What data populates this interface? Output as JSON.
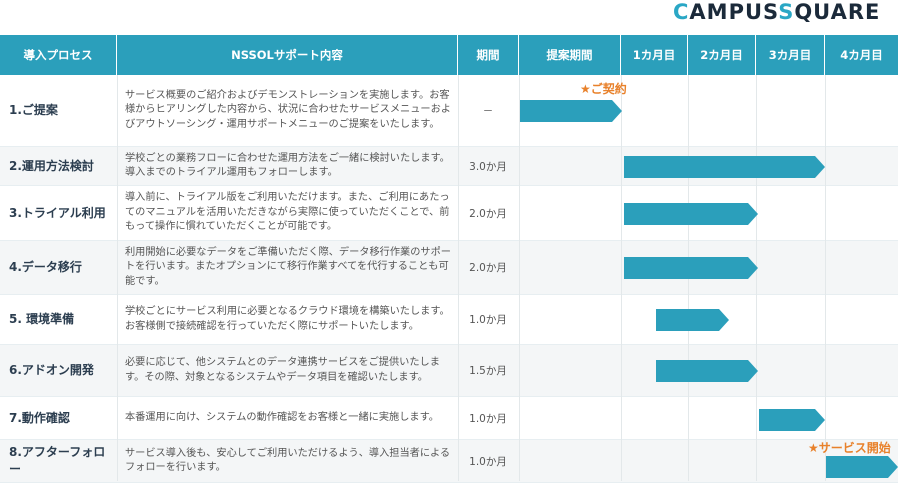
{
  "logo": {
    "part1": "C",
    "part2": "AMPUS",
    "part3": "S",
    "part4": "QUARE"
  },
  "headers": {
    "process": "導入プロセス",
    "content": "NSSOLサポート内容",
    "period": "期間",
    "proposal": "提案期間",
    "m1": "1カ月目",
    "m2": "2カ月目",
    "m3": "3カ月目",
    "m4": "4カ月目"
  },
  "rows": [
    {
      "process": "1.ご提案",
      "content": "サービス概要のご紹介およびデモンストレーションを実施します。お客様からヒアリングした内容から、状況に合わせたサービスメニューおよびアウトソーシング・運用サポートメニューのご提案をいたします。",
      "period": "－"
    },
    {
      "process": "2.運用方法検討",
      "content": "学校ごとの業務フローに合わせた運用方法をご一緒に検討いたします。導入までのトライアル運用もフォローします。",
      "period": "3.0か月"
    },
    {
      "process": "3.トライアル利用",
      "content": "導入前に、トライアル版をご利用いただけます。また、ご利用にあたってのマニュアルを活用いただきながら実際に使っていただくことで、前もって操作に慣れていただくことが可能です。",
      "period": "2.0か月"
    },
    {
      "process": "4.データ移行",
      "content": "利用開始に必要なデータをご準備いただく際、データ移行作業のサポートを行います。またオプションにて移行作業すべてを代行することも可能です。",
      "period": "2.0か月"
    },
    {
      "process": "5. 環境準備",
      "content": "学校ごとにサービス利用に必要となるクラウド環境を構築いたします。お客様側で接続確認を行っていただく際にサポートいたします。",
      "period": "1.0か月"
    },
    {
      "process": "6.アドオン開発",
      "content": "必要に応じて、他システムとのデータ連携サービスをご提供いたします。その際、対象となるシステムやデータ項目を確認いたします。",
      "period": "1.5か月"
    },
    {
      "process": "7.動作確認",
      "content": "本番運用に向け、システムの動作確認をお客様と一緒に実施します。",
      "period": "1.0か月"
    },
    {
      "process": "8.アフターフォロー",
      "content": "サービス導入後も、安心してご利用いただけるよう、導入担当者によるフォローを行います。",
      "period": "1.0か月"
    }
  ],
  "milestones": {
    "contract": "★ご契約",
    "service_start": "★サービス開始"
  },
  "colors": {
    "header": "#2b9fbb",
    "bar": "#2b9fbb",
    "milestone": "#e8812b",
    "logo_accent": "#2aa7c5"
  }
}
